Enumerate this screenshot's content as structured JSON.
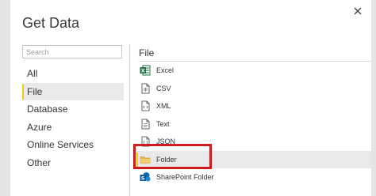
{
  "dialog": {
    "title": "Get Data",
    "close_icon": "close-icon"
  },
  "search": {
    "placeholder": "Search",
    "value": ""
  },
  "categories": [
    {
      "label": "All",
      "selected": false
    },
    {
      "label": "File",
      "selected": true
    },
    {
      "label": "Database",
      "selected": false
    },
    {
      "label": "Azure",
      "selected": false
    },
    {
      "label": "Online Services",
      "selected": false
    },
    {
      "label": "Other",
      "selected": false
    }
  ],
  "section": {
    "title": "File",
    "items": [
      {
        "label": "Excel",
        "icon": "excel-icon",
        "selected": false
      },
      {
        "label": "CSV",
        "icon": "csv-file-icon",
        "selected": false
      },
      {
        "label": "XML",
        "icon": "xml-file-icon",
        "selected": false
      },
      {
        "label": "Text",
        "icon": "text-file-icon",
        "selected": false
      },
      {
        "label": "JSON",
        "icon": "json-file-icon",
        "selected": false
      },
      {
        "label": "Folder",
        "icon": "folder-icon",
        "selected": true
      },
      {
        "label": "SharePoint Folder",
        "icon": "sharepoint-icon",
        "selected": false
      }
    ]
  },
  "colors": {
    "selection_bar": "#f2c811",
    "highlight_box": "#cc1a1f",
    "excel_green": "#1e7145",
    "sharepoint_blue": "#0b6cb6",
    "folder_yellow": "#e8b84d"
  }
}
